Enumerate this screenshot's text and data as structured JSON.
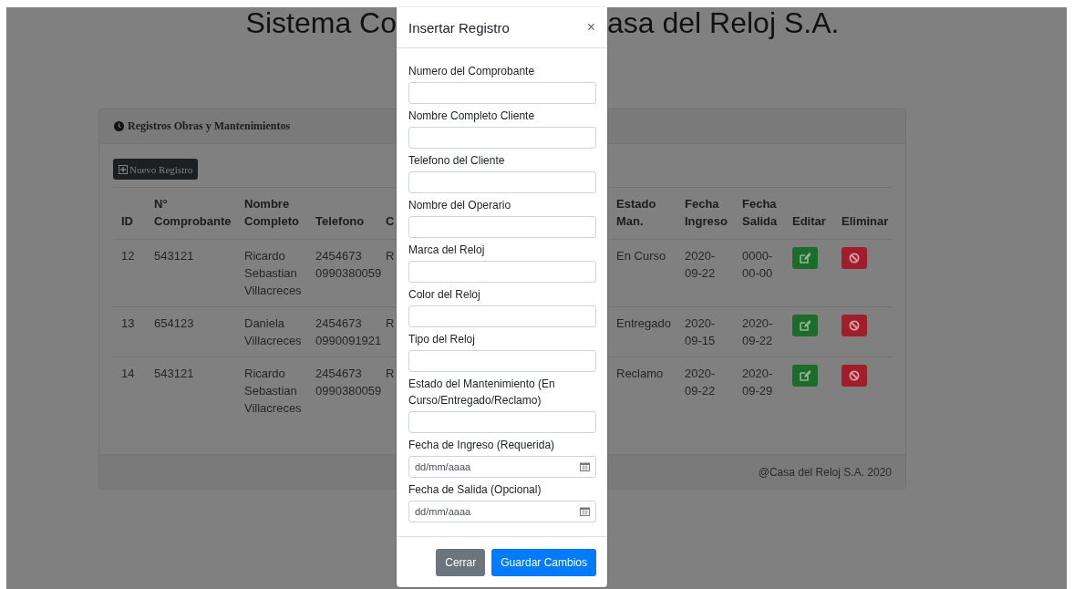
{
  "page_title": {
    "left": "Sistema Co",
    "right": "asa del Reloj S.A."
  },
  "card": {
    "title": "Registros Obras y Mantenimientos",
    "new_button": "Nuevo Registro",
    "table": {
      "columns": [
        {
          "lines": [
            "ID"
          ]
        },
        {
          "lines": [
            "N°",
            "Comprobante"
          ]
        },
        {
          "lines": [
            "Nombre",
            "Completo"
          ]
        },
        {
          "lines": [
            "Telefono"
          ]
        },
        {
          "lines": [
            "C"
          ]
        },
        {
          "lines": [
            "Estado",
            "Man."
          ]
        },
        {
          "lines": [
            "Fecha",
            "Ingreso"
          ]
        },
        {
          "lines": [
            "Fecha",
            "Salida"
          ]
        },
        {
          "lines": [
            "Editar"
          ]
        },
        {
          "lines": [
            "Eliminar"
          ]
        }
      ],
      "rows": [
        {
          "id": "12",
          "comprobante": "543121",
          "nombre": "Ricardo Sebastian Villacreces",
          "telefono": [
            "2454673",
            "0990380059"
          ],
          "column_5": "R",
          "estado": "En Curso",
          "ingreso": "2020-09-22",
          "salida": "0000-00-00"
        },
        {
          "id": "13",
          "comprobante": "654123",
          "nombre": "Daniela Villacreces",
          "telefono": [
            "2454673",
            "0990091921"
          ],
          "column_5": "R",
          "estado": "Entregado",
          "ingreso": "2020-09-15",
          "salida": "2020-09-22"
        },
        {
          "id": "14",
          "comprobante": "543121",
          "nombre": "Ricardo Sebastian Villacreces",
          "telefono": [
            "2454673",
            "0990380059"
          ],
          "column_5": "R",
          "estado": "Reclamo",
          "ingreso": "2020-09-22",
          "salida": "2020-09-29"
        }
      ]
    },
    "footer": "@Casa del Reloj S.A. 2020"
  },
  "modal": {
    "title": "Insertar Registro",
    "close": "×",
    "fields": [
      {
        "kind": "text",
        "label": "Numero del Comprobante"
      },
      {
        "kind": "text",
        "label": "Nombre Completo Cliente"
      },
      {
        "kind": "text",
        "label": "Telefono del Cliente"
      },
      {
        "kind": "text",
        "label": "Nombre del Operario"
      },
      {
        "kind": "text",
        "label": "Marca del Reloj"
      },
      {
        "kind": "text",
        "label": "Color del Reloj"
      },
      {
        "kind": "text",
        "label": "Tipo del Reloj"
      },
      {
        "kind": "text",
        "label": "Estado del Mantenimiento (En Curso/Entregado/Reclamo)"
      },
      {
        "kind": "date",
        "label": "Fecha de Ingreso (Requerida)",
        "placeholder": "dd/mm/aaaa"
      },
      {
        "kind": "date",
        "label": "Fecha de Salida (Opcional)",
        "placeholder": "dd/mm/aaaa"
      }
    ],
    "buttons": [
      {
        "kind": "secondary",
        "label": "Cerrar"
      },
      {
        "kind": "primary",
        "label": "Guardar Cambios"
      }
    ]
  }
}
